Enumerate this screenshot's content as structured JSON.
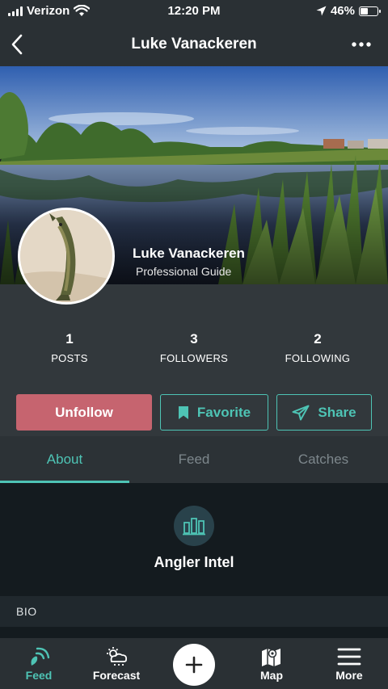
{
  "status_bar": {
    "carrier": "Verizon",
    "time": "12:20 PM",
    "battery": "46%",
    "battery_level": 0.46,
    "icons": [
      "signal-icon",
      "wifi-icon",
      "location-arrow-icon",
      "battery-icon"
    ]
  },
  "header": {
    "title": "Luke Vanackeren",
    "back_icon": "chevron-left-icon",
    "menu_icon": "more-dots-icon"
  },
  "profile": {
    "name": "Luke Vanackeren",
    "role": "Professional Guide"
  },
  "stats": [
    {
      "value": "1",
      "label": "POSTS"
    },
    {
      "value": "3",
      "label": "FOLLOWERS"
    },
    {
      "value": "2",
      "label": "FOLLOWING"
    }
  ],
  "actions": {
    "unfollow": "Unfollow",
    "favorite": "Favorite",
    "share": "Share"
  },
  "tabs": [
    {
      "label": "About",
      "active": true
    },
    {
      "label": "Feed",
      "active": false
    },
    {
      "label": "Catches",
      "active": false
    }
  ],
  "content": {
    "intel_title": "Angler Intel",
    "bio_label": "BIO"
  },
  "nav": [
    {
      "label": "Feed",
      "icon": "feed-icon",
      "active": true
    },
    {
      "label": "Forecast",
      "icon": "forecast-icon",
      "active": false
    },
    {
      "label": "",
      "icon": "plus-icon",
      "active": false
    },
    {
      "label": "Map",
      "icon": "map-icon",
      "active": false
    },
    {
      "label": "More",
      "icon": "hamburger-icon",
      "active": false
    }
  ],
  "colors": {
    "accent": "#4ec4b5",
    "unfollow": "#c6646f",
    "background": "#1c2227"
  }
}
